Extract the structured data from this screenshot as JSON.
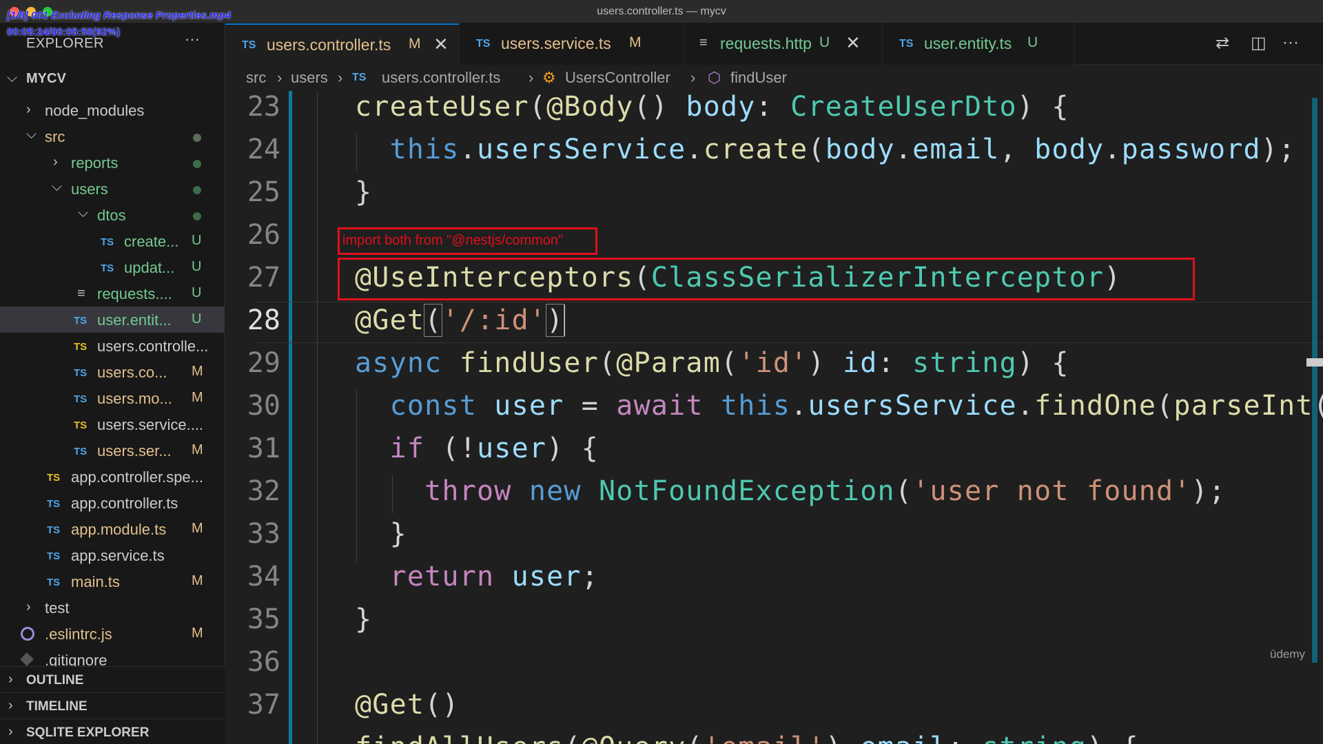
{
  "window": {
    "title": "users.controller.ts — mycv",
    "overlay_video": "[1/8] 001 Excluding Response Properties.mp4",
    "overlay_time": "00:05:24/00:05:50(92%)"
  },
  "explorer": {
    "header": "EXPLORER",
    "more": "···",
    "project": "MYCV",
    "items": [
      {
        "label": "node_modules",
        "status": ""
      },
      {
        "label": "src",
        "status": ""
      },
      {
        "label": "reports",
        "status": ""
      },
      {
        "label": "users",
        "status": ""
      },
      {
        "label": "dtos",
        "status": ""
      },
      {
        "label": "create...",
        "icon": "TS",
        "status": "U"
      },
      {
        "label": "updat...",
        "icon": "TS",
        "status": "U"
      },
      {
        "label": "requests....",
        "status": "U"
      },
      {
        "label": "user.entit...",
        "icon": "TS",
        "status": "U"
      },
      {
        "label": "users.controlle...",
        "icon": "TS",
        "status": ""
      },
      {
        "label": "users.co...",
        "icon": "TS",
        "status": "M"
      },
      {
        "label": "users.mo...",
        "icon": "TS",
        "status": "M"
      },
      {
        "label": "users.service....",
        "icon": "TS",
        "status": ""
      },
      {
        "label": "users.ser...",
        "icon": "TS",
        "status": "M"
      },
      {
        "label": "app.controller.spe...",
        "icon": "TS",
        "status": ""
      },
      {
        "label": "app.controller.ts",
        "icon": "TS",
        "status": ""
      },
      {
        "label": "app.module.ts",
        "icon": "TS",
        "status": "M"
      },
      {
        "label": "app.service.ts",
        "icon": "TS",
        "status": ""
      },
      {
        "label": "main.ts",
        "icon": "TS",
        "status": "M"
      },
      {
        "label": "test",
        "status": ""
      },
      {
        "label": ".eslintrc.js",
        "status": "M"
      },
      {
        "label": ".gitignore",
        "status": ""
      }
    ],
    "sections": [
      "OUTLINE",
      "TIMELINE",
      "SQLITE EXPLORER"
    ]
  },
  "tabs": [
    {
      "icon": "TS",
      "name": "users.controller.ts",
      "flag": "M",
      "close": "✕",
      "active": true
    },
    {
      "icon": "TS",
      "name": "users.service.ts",
      "flag": "M"
    },
    {
      "name": "requests.http",
      "flag": "U",
      "close": "✕"
    },
    {
      "icon": "TS",
      "name": "user.entity.ts",
      "flag": "U"
    }
  ],
  "breadcrumb": [
    "src",
    "users",
    "users.controller.ts",
    "UsersController",
    "findUser"
  ],
  "ts_label": "TS",
  "editor": {
    "line_numbers": [
      "23",
      "24",
      "25",
      "26",
      "27",
      "28",
      "29",
      "30",
      "31",
      "32",
      "33",
      "34",
      "35",
      "36",
      "37"
    ],
    "annotation": "import both from \"@nestjs/common\""
  },
  "watermark": "ūdemy",
  "colors": {
    "accent": "#0078d4",
    "annotation_red": "#e0101b",
    "modified": "#e2c08d",
    "untracked": "#73c991"
  }
}
